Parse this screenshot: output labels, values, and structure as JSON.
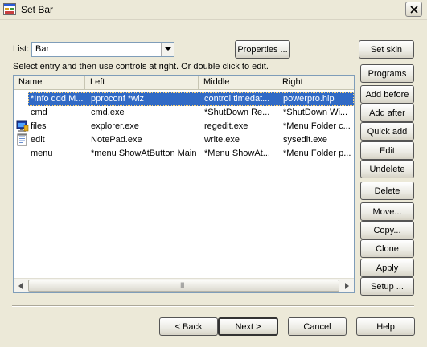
{
  "window": {
    "title": "Set Bar"
  },
  "toolbar": {
    "list_label": "List:",
    "list_value": "Bar",
    "properties_label": "Properties ...",
    "set_skin_label": "Set skin",
    "instructions": "Select entry and then use controls at right.  Or double click to edit."
  },
  "list": {
    "columns": [
      "Name",
      "Left",
      "Middle",
      "Right"
    ],
    "rows": [
      {
        "name": "*Info ddd M...",
        "left": "pproconf *wiz",
        "middle": "control timedat...",
        "right": "powerpro.hlp",
        "selected": true,
        "icon": "none"
      },
      {
        "name": "cmd",
        "left": "cmd.exe",
        "middle": "*ShutDown Re...",
        "right": "*ShutDown Wi...",
        "selected": false,
        "icon": "none"
      },
      {
        "name": "files",
        "left": "explorer.exe",
        "middle": "regedit.exe",
        "right": "*Menu Folder c...",
        "selected": false,
        "icon": "computer-icon"
      },
      {
        "name": "edit",
        "left": "NotePad.exe",
        "middle": "write.exe",
        "right": "sysedit.exe",
        "selected": false,
        "icon": "notepad-icon"
      },
      {
        "name": "menu",
        "left": "*menu ShowAtButton Main",
        "middle": "*Menu ShowAt...",
        "right": "*Menu Folder p...",
        "selected": false,
        "icon": "none"
      }
    ],
    "scroll_grip": "III"
  },
  "side_buttons": {
    "programs": "Programs",
    "add_before": "Add before",
    "add_after": "Add after",
    "quick_add": "Quick add",
    "edit": "Edit",
    "undelete": "Undelete",
    "delete": "Delete",
    "move": "Move...",
    "copy": "Copy...",
    "clone": "Clone",
    "apply": "Apply",
    "setup": "Setup ..."
  },
  "footer": {
    "back": "< Back",
    "next": "Next >",
    "cancel": "Cancel",
    "help": "Help"
  }
}
